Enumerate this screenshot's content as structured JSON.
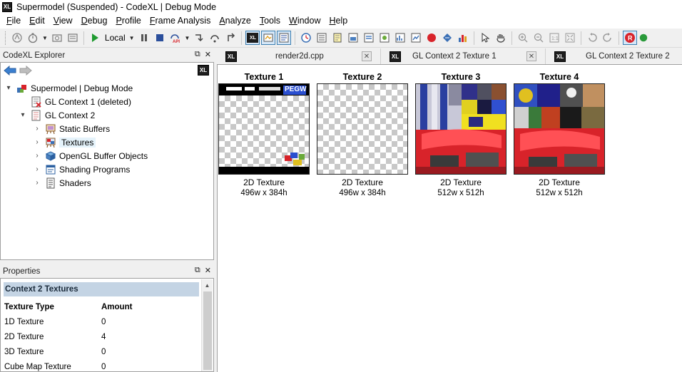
{
  "window": {
    "title": "Supermodel (Suspended) - CodeXL | Debug Mode",
    "app_icon": "XL"
  },
  "menu": [
    {
      "label": "File",
      "key": "F",
      "rest": "ile"
    },
    {
      "label": "Edit",
      "key": "E",
      "rest": "dit"
    },
    {
      "label": "View",
      "key": "V",
      "rest": "iew"
    },
    {
      "label": "Debug",
      "key": "D",
      "rest": "ebug"
    },
    {
      "label": "Profile",
      "key": "P",
      "rest": "rofile"
    },
    {
      "label": "Frame Analysis",
      "key": "F",
      "rest": "rame Analysis"
    },
    {
      "label": "Analyze",
      "key": "A",
      "rest": "nalyze"
    },
    {
      "label": "Tools",
      "key": "T",
      "rest": "ools"
    },
    {
      "label": "Window",
      "key": "W",
      "rest": "indow"
    },
    {
      "label": "Help",
      "key": "H",
      "rest": "elp"
    }
  ],
  "toolbar": {
    "target_label": "Local",
    "badge": "XL"
  },
  "explorer": {
    "title": "CodeXL Explorer",
    "badge": "XL",
    "tree": [
      {
        "label": "Supermodel | Debug Mode",
        "expander": "▾",
        "icon": "app-cubes-icon"
      },
      {
        "label": "GL Context 1 (deleted)",
        "expander": "",
        "icon": "context-deleted-icon"
      },
      {
        "label": "GL Context 2",
        "expander": "▾",
        "icon": "context-icon"
      },
      {
        "label": "Static Buffers",
        "expander": "›",
        "icon": "static-buffers-icon"
      },
      {
        "label": "Textures",
        "expander": "›",
        "icon": "textures-icon"
      },
      {
        "label": "OpenGL Buffer Objects",
        "expander": "›",
        "icon": "buffer-objects-icon"
      },
      {
        "label": "Shading Programs",
        "expander": "›",
        "icon": "shading-programs-icon"
      },
      {
        "label": "Shaders",
        "expander": "›",
        "icon": "shaders-icon"
      }
    ]
  },
  "properties": {
    "title": "Properties",
    "section": "Context 2 Textures",
    "headers": [
      "Texture Type",
      "Amount"
    ],
    "rows": [
      [
        "1D Texture",
        "0"
      ],
      [
        "2D Texture",
        "4"
      ],
      [
        "3D Texture",
        "0"
      ],
      [
        "Cube Map Texture",
        "0"
      ]
    ]
  },
  "tabs": [
    {
      "label": "render2d.cpp",
      "badge": "XL"
    },
    {
      "label": "GL Context 2 Texture 1",
      "badge": "XL"
    },
    {
      "label": "GL Context 2 Texture 2",
      "badge": "XL"
    }
  ],
  "textures": [
    {
      "title": "Texture 1",
      "type": "2D Texture",
      "size": "496w x 384h",
      "thumb_text": "PEGW"
    },
    {
      "title": "Texture 2",
      "type": "2D Texture",
      "size": "496w x 384h"
    },
    {
      "title": "Texture 3",
      "type": "2D Texture",
      "size": "512w x 512h"
    },
    {
      "title": "Texture 4",
      "type": "2D Texture",
      "size": "512w x 512h"
    }
  ],
  "colors": {
    "accent_blue": "#3c7fb1",
    "props_header": "#c4d4e4",
    "car_red": "#d8232a"
  }
}
